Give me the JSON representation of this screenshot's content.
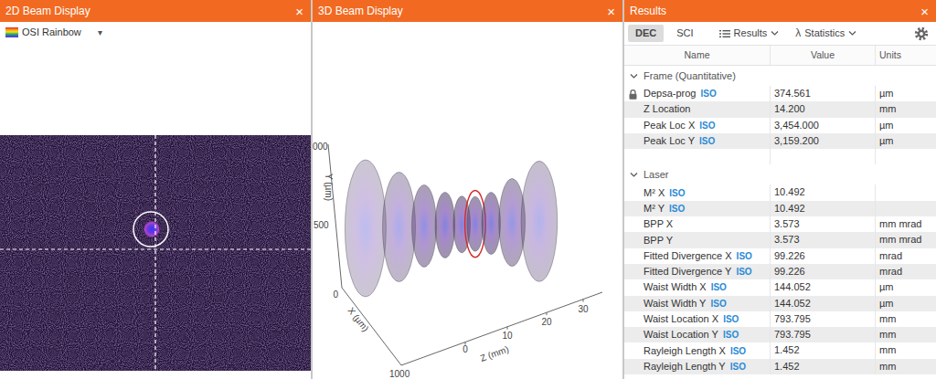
{
  "beam_2d": {
    "title": "2D Beam Display",
    "close": "×",
    "colormap": {
      "label": "OSI Rainbow",
      "caret": "▾"
    }
  },
  "beam_3d": {
    "title": "3D Beam Display",
    "close": "×",
    "y_axis": {
      "title": "Y (µm)",
      "ticks": [
        "000",
        "500",
        "0"
      ]
    },
    "x_axis": {
      "title": "X (µm)",
      "ticks": [
        "1000"
      ]
    },
    "z_axis": {
      "title": "Z (mm)",
      "ticks": [
        "0",
        "10",
        "20",
        "30"
      ]
    },
    "slices": [
      {
        "z": -12,
        "width": 300,
        "selected": false
      },
      {
        "z": -4,
        "width": 240,
        "selected": false
      },
      {
        "z": 2,
        "width": 180,
        "selected": false
      },
      {
        "z": 7,
        "width": 144,
        "selected": false
      },
      {
        "z": 11,
        "width": 124,
        "selected": false
      },
      {
        "z": 14.2,
        "width": 120,
        "selected": true
      },
      {
        "z": 18,
        "width": 136,
        "selected": false
      },
      {
        "z": 23,
        "width": 192,
        "selected": false
      },
      {
        "z": 29.5,
        "width": 264,
        "selected": false
      }
    ]
  },
  "results": {
    "title": "Results",
    "close": "×",
    "formats": [
      {
        "label": "DEC",
        "selected": true
      },
      {
        "label": "SCI",
        "selected": false
      }
    ],
    "menus": [
      {
        "label": "Results",
        "kind": "list"
      },
      {
        "label": "Statistics",
        "kind": "lambda",
        "glyph": "λ"
      }
    ],
    "columns": [
      "Name",
      "Value",
      "Units"
    ],
    "groups": [
      {
        "name": "Frame (Quantitative)",
        "expanded": true,
        "rows": [
          {
            "name": "Depsa-prog",
            "tag": "ISO",
            "value": "374.561",
            "units": "µm",
            "locked": true
          },
          {
            "name": "Z Location",
            "tag": "",
            "value": "14.200",
            "units": "mm",
            "locked": false
          },
          {
            "name": "Peak Loc X",
            "tag": "ISO",
            "value": "3,454.000",
            "units": "µm",
            "locked": false
          },
          {
            "name": "Peak Loc Y",
            "tag": "ISO",
            "value": "3,159.200",
            "units": "µm",
            "locked": false
          },
          {
            "name": "",
            "tag": "",
            "value": "",
            "units": "",
            "locked": false
          }
        ]
      },
      {
        "name": "Laser",
        "expanded": true,
        "rows": [
          {
            "name": "M² X",
            "tag": "ISO",
            "value": "10.492",
            "units": "",
            "locked": false
          },
          {
            "name": "M² Y",
            "tag": "ISO",
            "value": "10.492",
            "units": "",
            "locked": false
          },
          {
            "name": "BPP X",
            "tag": "",
            "value": "3.573",
            "units": "mm mrad",
            "locked": false
          },
          {
            "name": "BPP Y",
            "tag": "",
            "value": "3.573",
            "units": "mm mrad",
            "locked": false
          },
          {
            "name": "Fitted Divergence X",
            "tag": "ISO",
            "value": "99.226",
            "units": "mrad",
            "locked": false
          },
          {
            "name": "Fitted Divergence Y",
            "tag": "ISO",
            "value": "99.226",
            "units": "mrad",
            "locked": false
          },
          {
            "name": "Waist Width X",
            "tag": "ISO",
            "value": "144.052",
            "units": "µm",
            "locked": false
          },
          {
            "name": "Waist Width Y",
            "tag": "ISO",
            "value": "144.052",
            "units": "µm",
            "locked": false
          },
          {
            "name": "Waist Location X",
            "tag": "ISO",
            "value": "793.795",
            "units": "mm",
            "locked": false
          },
          {
            "name": "Waist Location Y",
            "tag": "ISO",
            "value": "793.795",
            "units": "mm",
            "locked": false
          },
          {
            "name": "Rayleigh Length X",
            "tag": "ISO",
            "value": "1.452",
            "units": "mm",
            "locked": false
          },
          {
            "name": "Rayleigh Length Y",
            "tag": "ISO",
            "value": "1.452",
            "units": "mm",
            "locked": false
          }
        ]
      }
    ]
  }
}
